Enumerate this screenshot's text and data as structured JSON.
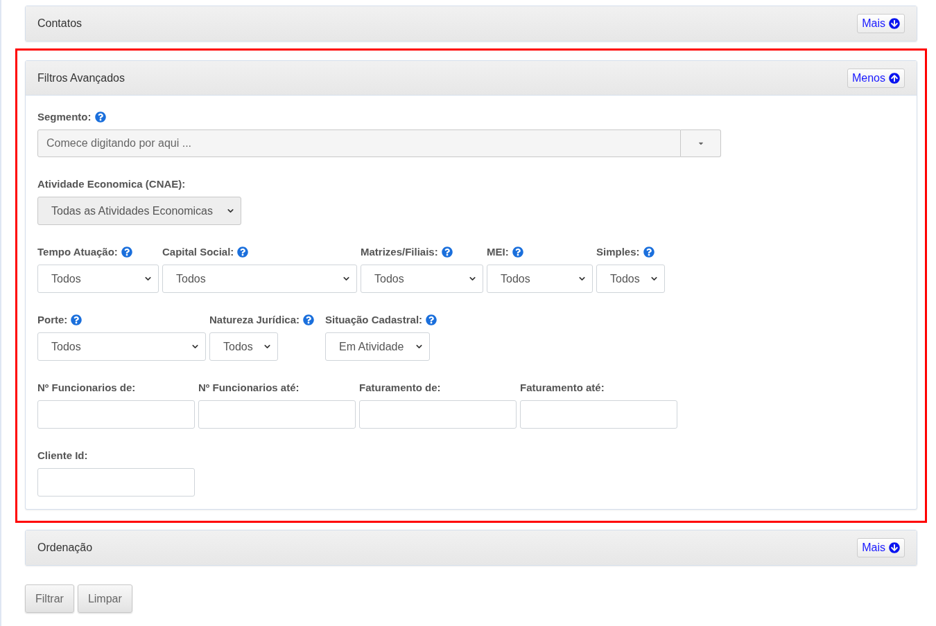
{
  "panels": [
    {
      "title": "Contatos",
      "toggle": "Mais",
      "expanded": false,
      "highlighted": false
    },
    {
      "title": "Filtros Avançados",
      "toggle": "Menos",
      "expanded": true,
      "highlighted": true,
      "rows": [
        [
          {
            "kind": "combo",
            "label": "Segmento:",
            "help": true,
            "placeholder": "Comece digitando por aqui ..."
          }
        ],
        [
          {
            "kind": "picker",
            "label": "Atividade Economica (CNAE):",
            "help": false,
            "value": "Todas as Atividades Economicas"
          }
        ],
        [
          {
            "kind": "select",
            "label": "Tempo Atuação:",
            "help": true,
            "value": "Todos"
          },
          {
            "kind": "select",
            "label": "Capital Social:",
            "help": true,
            "value": "Todos"
          },
          {
            "kind": "select",
            "label": "Matrizes/Filiais:",
            "help": true,
            "value": "Todos"
          },
          {
            "kind": "select",
            "label": "MEI:",
            "help": true,
            "value": "Todos"
          },
          {
            "kind": "select",
            "label": "Simples:",
            "help": true,
            "value": "Todos"
          }
        ],
        [
          {
            "kind": "select",
            "label": "Porte:",
            "help": true,
            "value": "Todos"
          },
          {
            "kind": "select",
            "label": "Natureza Jurídica:",
            "help": true,
            "value": "Todos"
          },
          {
            "kind": "select",
            "label": "Situação Cadastral:",
            "help": true,
            "value": "Em Atividade"
          }
        ],
        [
          {
            "kind": "text",
            "label": "Nº Funcionarios de:",
            "help": false
          },
          {
            "kind": "text",
            "label": "Nº Funcionarios até:",
            "help": false
          },
          {
            "kind": "text",
            "label": "Faturamento de:",
            "help": false
          },
          {
            "kind": "text",
            "label": "Faturamento até:",
            "help": false
          }
        ],
        [
          {
            "kind": "text",
            "label": "Cliente Id:",
            "help": false
          }
        ]
      ]
    },
    {
      "title": "Ordenação",
      "toggle": "Mais",
      "expanded": false,
      "highlighted": false
    }
  ],
  "buttons": [
    {
      "label": "Filtrar"
    },
    {
      "label": "Limpar"
    }
  ]
}
